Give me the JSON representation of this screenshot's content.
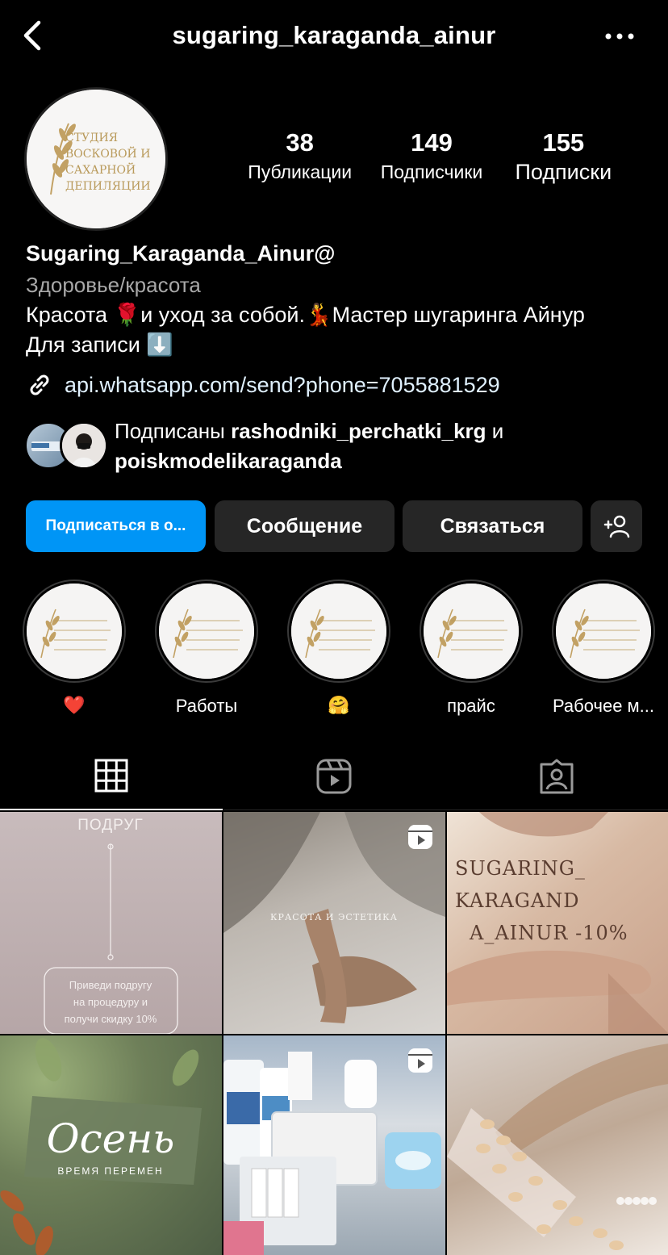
{
  "header": {
    "username": "sugaring_karaganda_ainur"
  },
  "avatar": {
    "logo_lines": [
      "СТУДИЯ",
      "ВОСКОВОЙ И",
      "САХАРНОЙ",
      "ДЕПИЛЯЦИИ"
    ]
  },
  "stats": [
    {
      "value": "38",
      "label": "Публикации"
    },
    {
      "value": "149",
      "label": "Подписчики"
    },
    {
      "value": "155",
      "label": "Подписки"
    }
  ],
  "bio": {
    "name": "Sugaring_Karaganda_Ainur@",
    "category": "Здоровье/красота",
    "line1_a": "Красота ",
    "line1_emoji1": "🌹",
    "line1_b": "и уход за собой.",
    "line1_emoji2": "💃",
    "line1_c": "Мастер шугаринга Айнур",
    "line2": "Для записи ",
    "line2_emoji": "⬇️",
    "link": "api.whatsapp.com/send?phone=7055881529"
  },
  "followed_by": {
    "prefix": "Подписаны ",
    "user1": "rashodniki_perchatki_krg",
    "joiner": " и",
    "user2": "poiskmodelikaraganda"
  },
  "buttons": {
    "follow": "Подписаться в о...",
    "message": "Сообщение",
    "contact": "Связаться"
  },
  "highlights": [
    {
      "label": "❤️"
    },
    {
      "label": "Работы"
    },
    {
      "label": "🤗"
    },
    {
      "label": "прайс"
    },
    {
      "label": "Рабочее м..."
    }
  ],
  "posts": {
    "p1_title": "ПОДРУГ",
    "p1_text": [
      "Приведи подругу",
      "на процедуру и",
      "получи скидку 10%"
    ],
    "p2_text": "КРАСОТА И ЭСТЕТИКА",
    "p3_text": [
      "SUGARING_",
      "KARAGAND",
      "A_AINUR -10%"
    ],
    "p4_title": "Осень",
    "p4_sub": "ВРЕМЯ ПЕРЕМЕН"
  },
  "colors": {
    "background": "#000000",
    "primary_button": "#0095f6",
    "secondary_button": "#262626",
    "muted_text": "#a8a8a8",
    "link_text": "#e0f1ff"
  }
}
